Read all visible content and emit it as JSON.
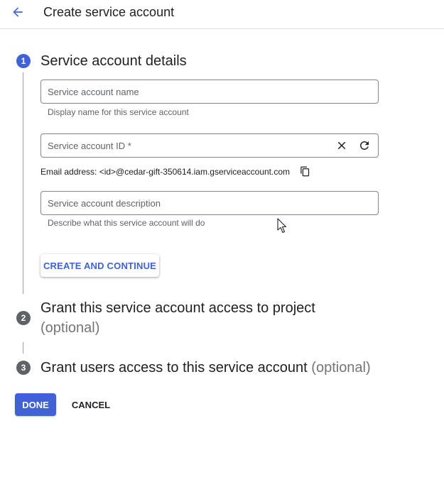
{
  "header": {
    "title": "Create service account",
    "back_icon": "arrow-back-icon"
  },
  "colors": {
    "accent": "#4062d6",
    "step_inactive": "#5f6368",
    "text": "#202124",
    "muted": "#5f6368"
  },
  "steps": [
    {
      "number": "1",
      "title": "Service account details",
      "optional": ""
    },
    {
      "number": "2",
      "title": "Grant this service account access to project",
      "optional": "(optional)"
    },
    {
      "number": "3",
      "title": "Grant users access to this service account",
      "optional": "(optional)"
    }
  ],
  "form": {
    "name": {
      "placeholder": "Service account name",
      "value": "",
      "hint": "Display name for this service account"
    },
    "id": {
      "placeholder": "Service account ID *",
      "value": "",
      "clear_icon": "close-icon",
      "refresh_icon": "refresh-icon"
    },
    "email": {
      "text": "Email address: <id>@cedar-gift-350614.iam.gserviceaccount.com",
      "copy_icon": "copy-icon"
    },
    "description": {
      "placeholder": "Service account description",
      "value": "",
      "hint": "Describe what this service account will do"
    }
  },
  "buttons": {
    "create_continue": "CREATE AND CONTINUE",
    "done": "DONE",
    "cancel": "CANCEL"
  }
}
